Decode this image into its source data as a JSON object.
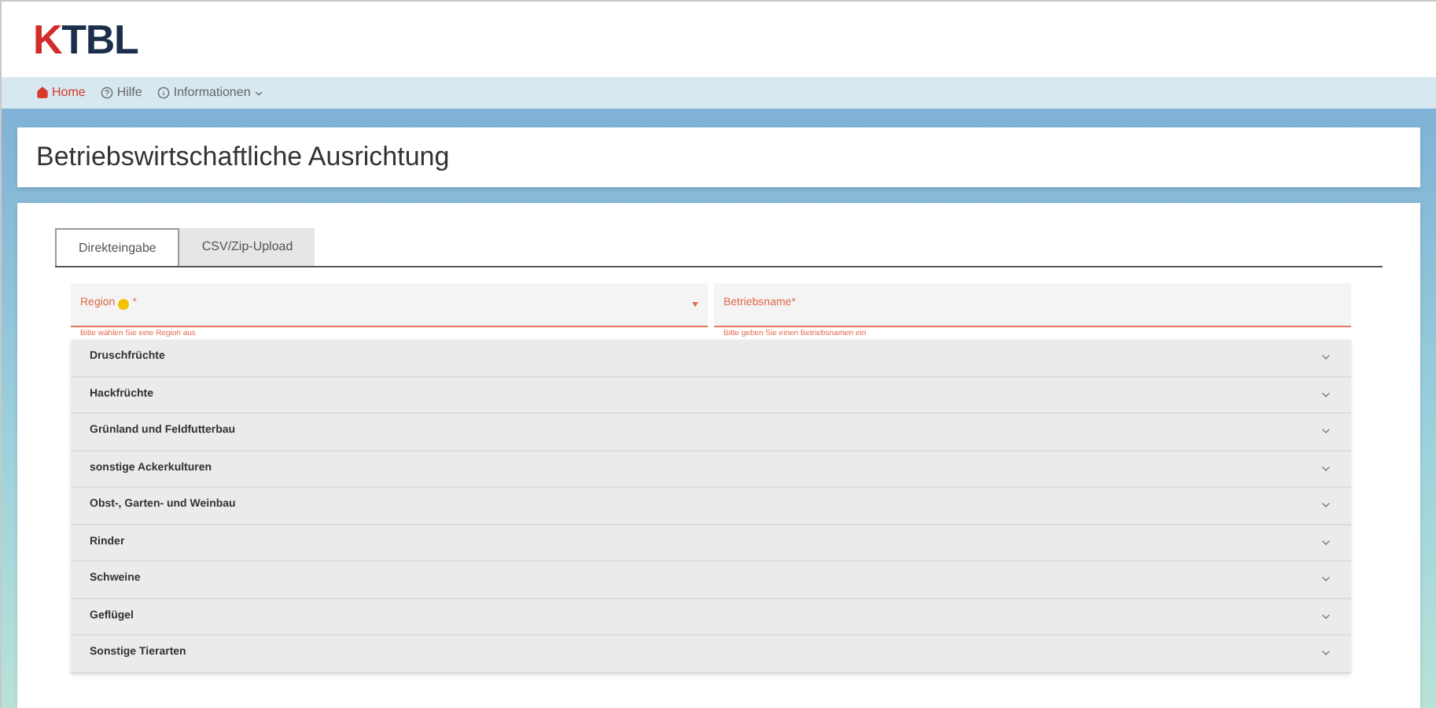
{
  "logo": "KTBL",
  "nav": [
    {
      "label": "Home",
      "kind": "home",
      "selected": true
    },
    {
      "label": "Hilfe",
      "kind": "help",
      "selected": false
    },
    {
      "label": "Informationen",
      "kind": "info",
      "selected": false
    }
  ],
  "page_title": "Betriebswirtschaftliche Ausrichtung",
  "tabs": [
    {
      "label": "Direkteingabe",
      "selected": true
    },
    {
      "label": "CSV/Zip-Upload",
      "selected": false
    }
  ],
  "fields": [
    {
      "label": "Region",
      "required_mark": "*",
      "kind": "select",
      "error": "Bitte wählen Sie eine Region aus"
    },
    {
      "label": "Betriebsname",
      "required_mark": "*",
      "kind": "text",
      "error": "Bitte geben Sie einen Betriebsnamen ein"
    }
  ],
  "sections": [
    {
      "label": "Druschfrüchte",
      "expanded": false
    },
    {
      "label": "Hackfrüchte",
      "expanded": false
    },
    {
      "label": "Grünland und Feldfutterbau",
      "expanded": false
    },
    {
      "label": "sonstige Ackerkulturen",
      "expanded": false
    },
    {
      "label": "Obst-, Garten- und Weinbau",
      "expanded": false
    },
    {
      "label": "Rinder",
      "expanded": false
    },
    {
      "label": "Schweine",
      "expanded": false
    },
    {
      "label": "Geflügel",
      "expanded": false
    },
    {
      "label": "Sonstige Tierarten",
      "expanded": false
    }
  ]
}
